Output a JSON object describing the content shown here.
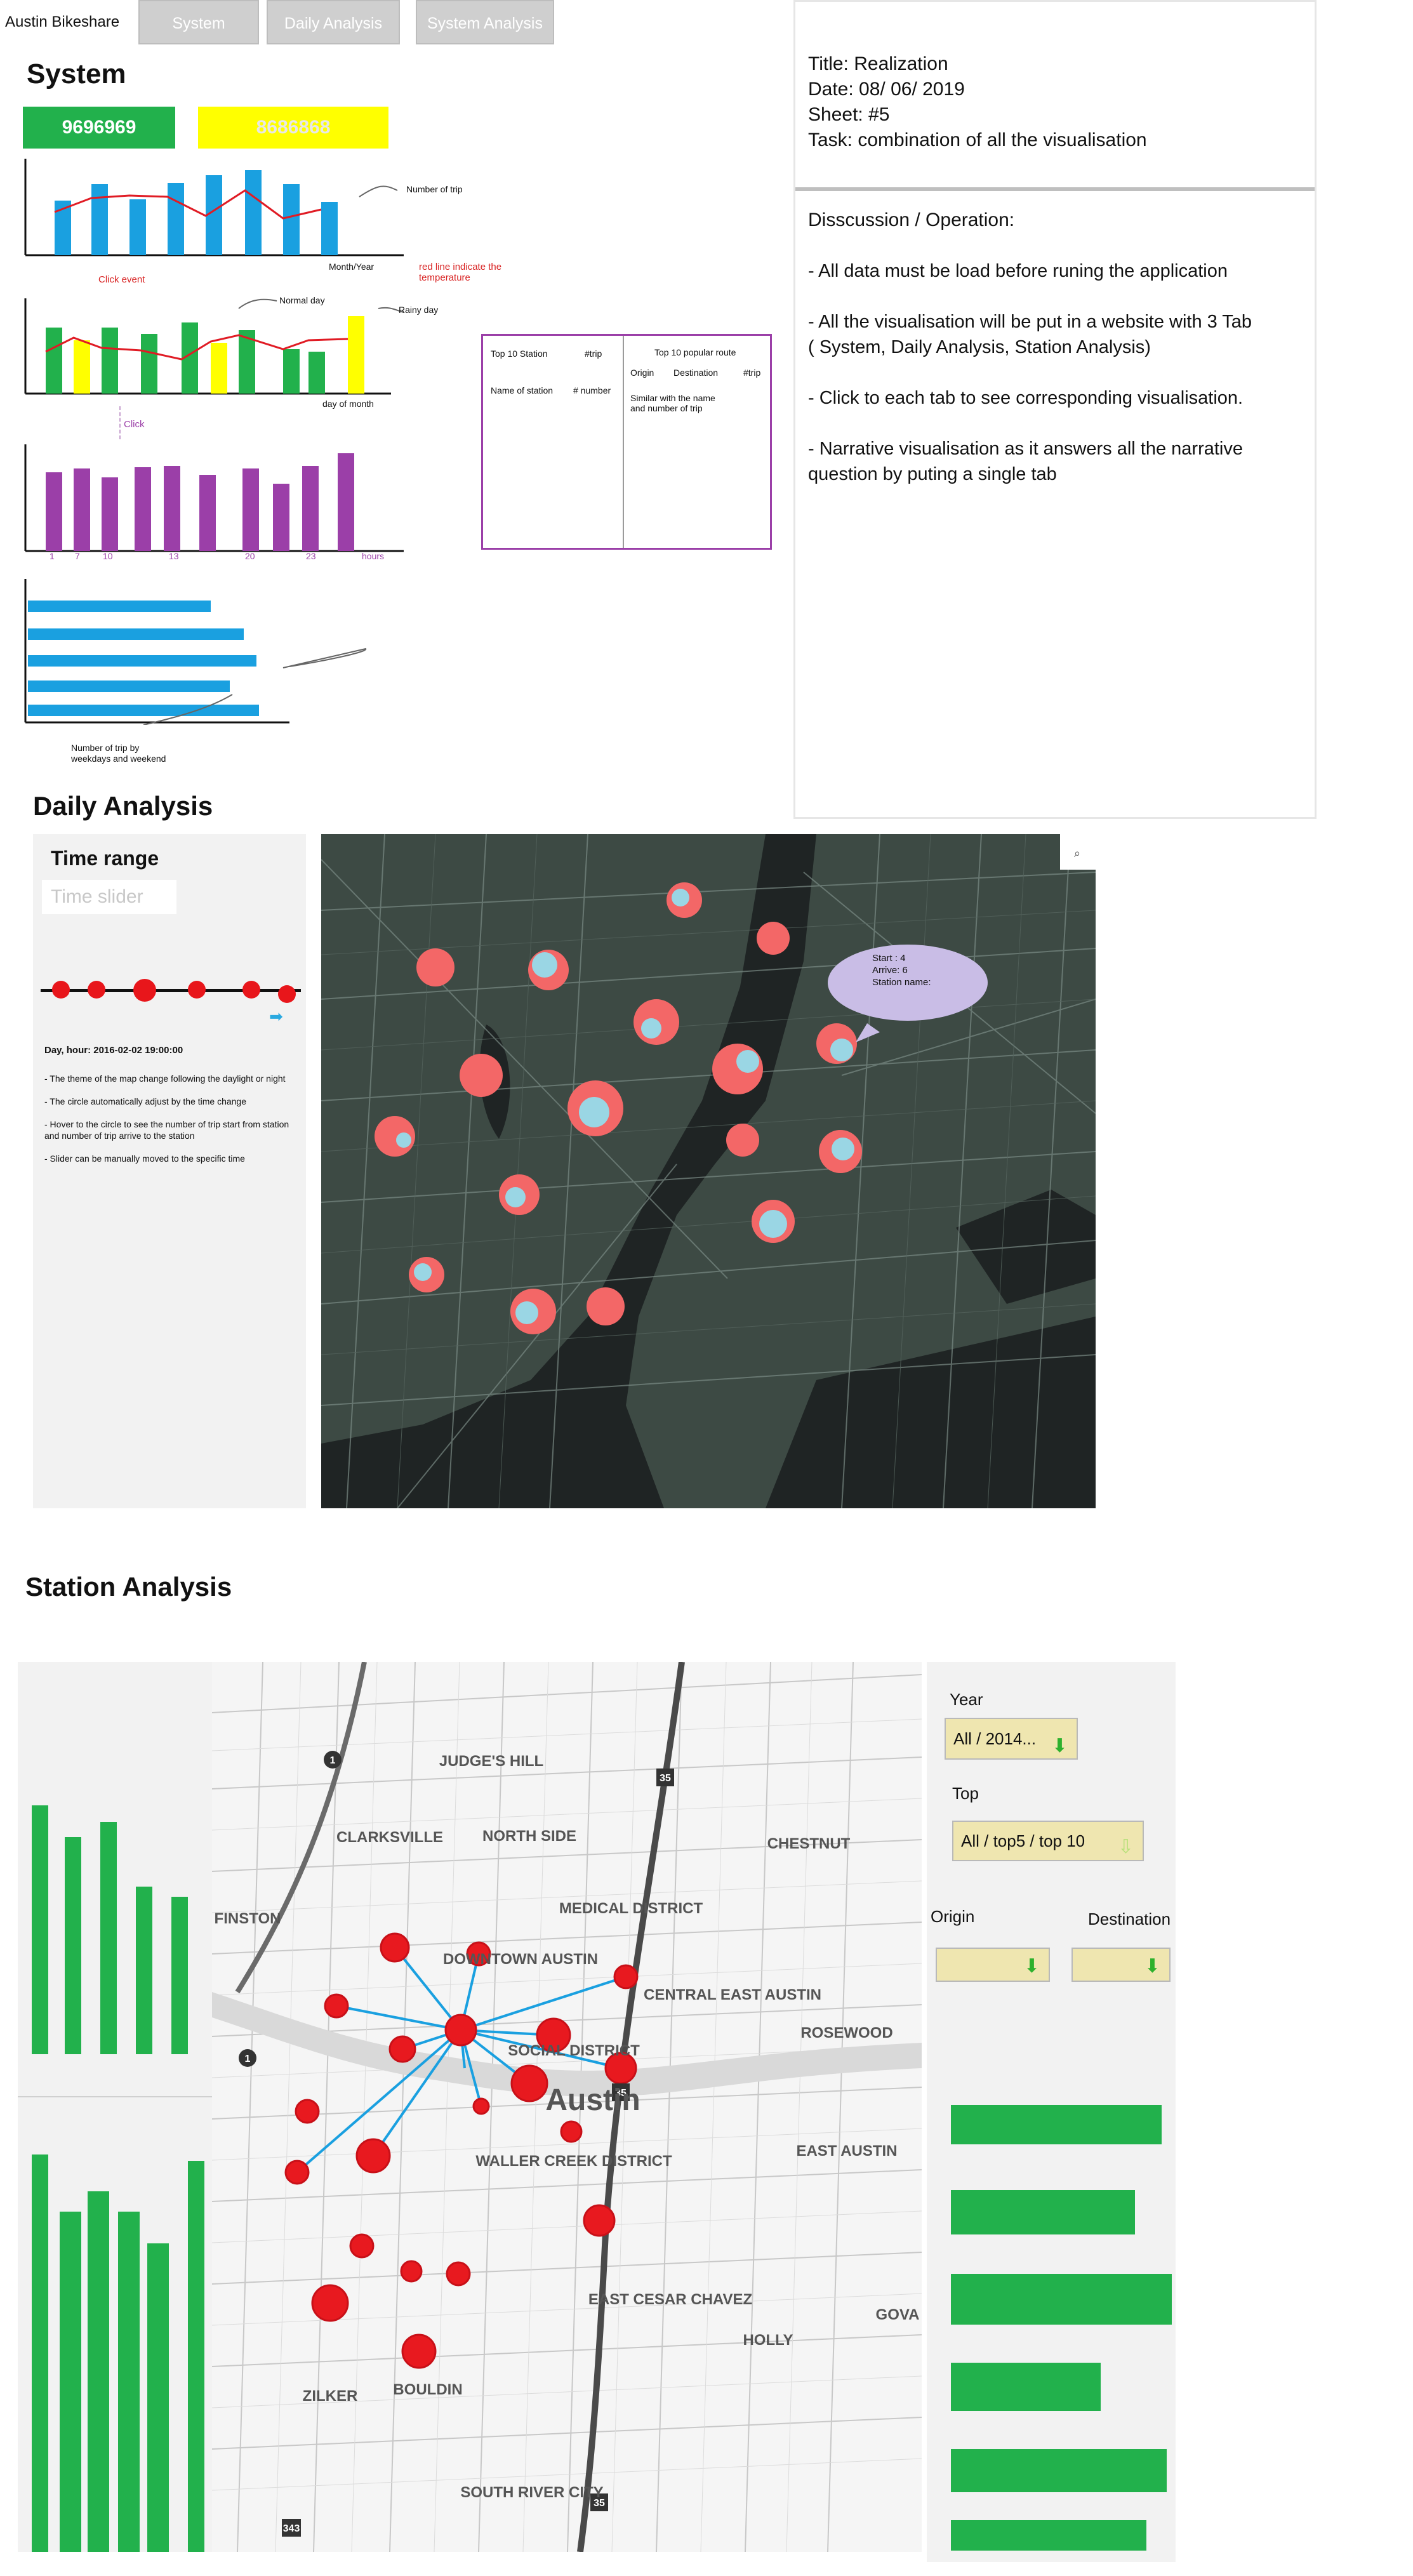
{
  "nav": {
    "brand": "Austin Bikeshare",
    "tabs": [
      {
        "label": "System"
      },
      {
        "label": "Daily Analysis"
      },
      {
        "label": "System Analysis"
      }
    ]
  },
  "system": {
    "title": "System",
    "kpis": [
      {
        "value": "9696969",
        "color": "#22b14c"
      },
      {
        "value": "8686868",
        "color": "#ffff00"
      }
    ],
    "chart1": {
      "annotation": "Number of trip",
      "xlabel": "Month/Year",
      "red_note": "red line indicate the temperature"
    },
    "click_event": "Click event",
    "chart2": {
      "normal_day": "Normal day",
      "rainy_day": "Rainy day",
      "xlabel": "day of month"
    },
    "click_note": "Click",
    "chart3": {
      "ticks": [
        "1",
        "7",
        "10",
        "13",
        "20",
        "23"
      ],
      "xlabel": "hours"
    },
    "chart4": {
      "caption_line1": "Number of trip by",
      "caption_line2": "weekdays and weekend"
    },
    "top_table": {
      "left_header": "Top 10 Station",
      "left_col": "#trip",
      "left_row": "Name of station",
      "left_row_val": "# number",
      "right_header": "Top 10 popular route",
      "right_cols": [
        "Origin",
        "Destination",
        "#trip"
      ],
      "right_note_1": "Similar with the name",
      "right_note_2": "and number of trip"
    }
  },
  "spec": {
    "title": "Title: Realization",
    "date": "Date: 08/ 06/ 2019",
    "sheet": "Sheet: #5",
    "task": "Task: combination of all the visualisation",
    "discussion_heading": "Disscussion / Operation:",
    "points": [
      "- All data must be load before runing the application",
      "- All the visualisation will be put in a website with 3 Tab ( System, Daily Analysis, Station Analysis)",
      "- Click to each tab to see corresponding visualisation.",
      "- Narrative visualisation as it answers all the narrative question by puting a single tab"
    ]
  },
  "daily": {
    "title": "Daily Analysis",
    "time_range": "Time range",
    "slider_placeholder": "Time slider",
    "day_hour": "Day, hour: 2016-02-02 19:00:00",
    "notes": [
      "- The theme of the map change following the daylight or night",
      "- The circle automatically adjust by the time change",
      "- Hover to the circle to see the number of trip start from station and number of trip arrive to the station",
      "- Slider can be manually moved to the specific time"
    ],
    "tooltip": {
      "start": "Start : 4",
      "arrive": "Arrive: 6",
      "station": "Station name:"
    },
    "search_icon": "search-icon"
  },
  "station": {
    "title": "Station Analysis",
    "year_label": "Year",
    "year_value": "All / 2014...",
    "top_label": "Top",
    "top_value": "All / top5 / top 10",
    "origin_label": "Origin",
    "destination_label": "Destination",
    "map_labels": [
      "JUDGE'S HILL",
      "CLARKSVILLE",
      "NORTH SIDE",
      "CHESTNUT",
      "MEDICAL DISTRICT",
      "DOWNTOWN AUSTIN",
      "CENTRAL EAST AUSTIN",
      "ROSEWOOD",
      "FINSTON",
      "SOCIAL DISTRICT",
      "Austin",
      "WALLER CREEK DISTRICT",
      "EAST AUSTIN",
      "EAST CESAR CHAVEZ",
      "HOLLY",
      "ZILKER",
      "BOULDIN",
      "SOUTH RIVER CITY",
      "GOVA"
    ],
    "highway_shields": [
      "1",
      "35",
      "1",
      "35",
      "343",
      "35"
    ]
  }
}
